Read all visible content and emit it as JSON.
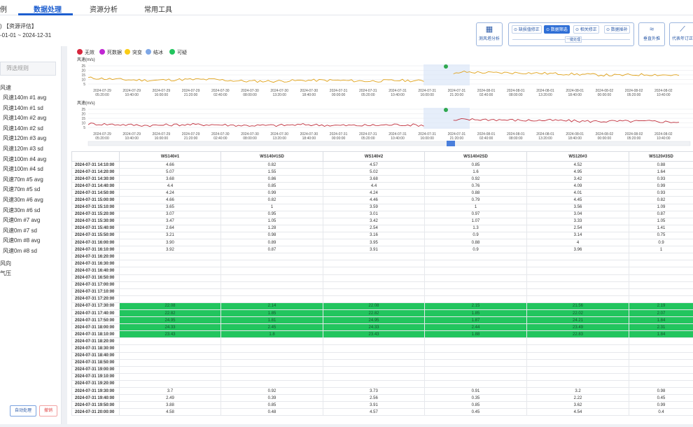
{
  "nav": {
    "tabs": [
      {
        "label": "例"
      },
      {
        "label": "数据处理"
      },
      {
        "label": "资源分析"
      },
      {
        "label": "常用工具"
      }
    ]
  },
  "header": {
    "project": ") 【资源评估】",
    "date_range": "-01-01 ~ 2024-12-31"
  },
  "toolbar": {
    "station_analysis": "测风塔分析",
    "group_items": [
      "缺损值修正",
      "数据筛选",
      "相关修正",
      "数据插补"
    ],
    "group_sub": "一键处理",
    "vertical_fit": "垂直外推",
    "rep_year": "代表年订正"
  },
  "sidebar": {
    "filter_placeholder": "筛选规则",
    "group_top": "风速",
    "items": [
      "风速140m #1 avg",
      "风速140m #1 sd",
      "风速140m #2 avg",
      "风速140m #2 sd",
      "风速120m #3 avg",
      "风速120m #3 sd",
      "风速100m #4 avg",
      "风速100m #4 sd",
      "风速70m #5 avg",
      "风速70m #5 sd",
      "风速30m #6 avg",
      "风速30m #6 sd",
      "风速0m #7 avg",
      "风速0m #7 sd",
      "风速0m #8 avg",
      "风速0m #8 sd"
    ],
    "group_dir": "风向",
    "group_pressure": "气压",
    "auto_btn": "自动处理",
    "undo_btn": "撤销"
  },
  "legend": [
    {
      "label": "无效",
      "color": "#d7263d"
    },
    {
      "label": "死数据",
      "color": "#c026d3"
    },
    {
      "label": "突变",
      "color": "#facc15"
    },
    {
      "label": "结冰",
      "color": "#7ea7e6"
    },
    {
      "label": "可疑",
      "color": "#22c55e"
    }
  ],
  "chart_data": [
    {
      "type": "line",
      "ylabel": "风速(m/s)",
      "yticks": [
        "25",
        "20",
        "15",
        "10",
        "5"
      ],
      "ylim": [
        0,
        25
      ],
      "series": [
        {
          "color": "#e0a21a"
        }
      ],
      "x": [
        "2024-07-29 05:20:00",
        "2024-07-29 10:40:00",
        "2024-07-29 16:00:00",
        "2024-07-29 21:20:00",
        "2024-07-30 02:40:00",
        "2024-07-30 08:00:00",
        "2024-07-30 13:20:00",
        "2024-07-30 18:40:00",
        "2024-07-31 00:00:00",
        "2024-07-31 05:20:00",
        "2024-07-31 10:40:00",
        "2024-07-31 16:00:00",
        "2024-07-31 21:20:00",
        "2024-08-01 02:40:00",
        "2024-08-01 08:00:00",
        "2024-08-01 13:20:00",
        "2024-08-01 18:40:00",
        "2024-08-02 00:00:00",
        "2024-08-02 05:20:00",
        "2024-08-02 10:40:00"
      ],
      "values": [
        9,
        7,
        6,
        7,
        7,
        5,
        5,
        6,
        6,
        5,
        6,
        5,
        16,
        15,
        15,
        14,
        13,
        12,
        13,
        12
      ]
    },
    {
      "type": "line",
      "ylabel": "风速(m/s)",
      "yticks": [
        "25",
        "20",
        "15",
        "10",
        "5"
      ],
      "ylim": [
        0,
        25
      ],
      "series": [
        {
          "color": "#c0303d"
        }
      ],
      "x": [
        "2024-07-29 05:20:00",
        "2024-07-29 10:40:00",
        "2024-07-29 16:00:00",
        "2024-07-29 21:20:00",
        "2024-07-30 02:40:00",
        "2024-07-30 08:00:00",
        "2024-07-30 13:20:00",
        "2024-07-30 18:40:00",
        "2024-07-31 00:00:00",
        "2024-07-31 05:20:00",
        "2024-07-31 10:40:00",
        "2024-07-31 16:00:00",
        "2024-07-31 21:20:00",
        "2024-08-01 02:40:00",
        "2024-08-01 08:00:00",
        "2024-08-01 13:20:00",
        "2024-08-01 18:40:00",
        "2024-08-02 00:00:00",
        "2024-08-02 05:20:00",
        "2024-08-02 10:40:00"
      ],
      "values": [
        6,
        5,
        4,
        5,
        5,
        4,
        4,
        5,
        4,
        4,
        5,
        4,
        11,
        11,
        10,
        10,
        9,
        9,
        9,
        8
      ]
    }
  ],
  "table": {
    "columns": [
      "",
      "WS140#1",
      "WS140#1SD",
      "WS140#2",
      "WS140#2SD",
      "WS120#3",
      "WS120#3SD"
    ],
    "rows": [
      {
        "ts": "2024-07-31 14:10:00",
        "v": [
          "4.66",
          "0.82",
          "4.57",
          "0.85",
          "4.52",
          "0.88"
        ]
      },
      {
        "ts": "2024-07-31 14:20:00",
        "v": [
          "5.07",
          "1.55",
          "5.02",
          "1.6",
          "4.95",
          "1.64"
        ]
      },
      {
        "ts": "2024-07-31 14:30:00",
        "v": [
          "3.68",
          "0.86",
          "3.68",
          "0.92",
          "3.42",
          "0.93"
        ]
      },
      {
        "ts": "2024-07-31 14:40:00",
        "v": [
          "4.4",
          "0.85",
          "4.4",
          "0.76",
          "4.09",
          "0.99"
        ]
      },
      {
        "ts": "2024-07-31 14:50:00",
        "v": [
          "4.24",
          "0.99",
          "4.24",
          "0.88",
          "4.01",
          "0.93"
        ]
      },
      {
        "ts": "2024-07-31 15:00:00",
        "v": [
          "4.66",
          "0.82",
          "4.46",
          "0.79",
          "4.45",
          "0.82"
        ]
      },
      {
        "ts": "2024-07-31 15:10:00",
        "v": [
          "3.65",
          "1",
          "3.59",
          "1",
          "3.56",
          "1.09"
        ]
      },
      {
        "ts": "2024-07-31 15:20:00",
        "v": [
          "3.07",
          "0.95",
          "3.01",
          "0.97",
          "3.04",
          "0.87"
        ]
      },
      {
        "ts": "2024-07-31 15:30:00",
        "v": [
          "3.47",
          "1.05",
          "3.42",
          "1.07",
          "3.33",
          "1.05"
        ]
      },
      {
        "ts": "2024-07-31 15:40:00",
        "v": [
          "2.64",
          "1.28",
          "2.54",
          "1.3",
          "2.54",
          "1.41"
        ]
      },
      {
        "ts": "2024-07-31 15:50:00",
        "v": [
          "3.21",
          "0.98",
          "3.16",
          "0.9",
          "3.14",
          "0.75"
        ]
      },
      {
        "ts": "2024-07-31 16:00:00",
        "v": [
          "3.90",
          "0.89",
          "3.95",
          "0.88",
          "4",
          "0.9"
        ]
      },
      {
        "ts": "2024-07-31 16:10:00",
        "v": [
          "3.92",
          "0.87",
          "3.91",
          "0.9",
          "3.96",
          "1"
        ]
      },
      {
        "ts": "2024-07-31 16:20:00",
        "v": [
          "",
          "",
          "",
          "",
          "",
          ""
        ]
      },
      {
        "ts": "2024-07-31 16:30:00",
        "v": [
          "",
          "",
          "",
          "",
          "",
          ""
        ]
      },
      {
        "ts": "2024-07-31 16:40:00",
        "v": [
          "",
          "",
          "",
          "",
          "",
          ""
        ]
      },
      {
        "ts": "2024-07-31 16:50:00",
        "v": [
          "",
          "",
          "",
          "",
          "",
          ""
        ]
      },
      {
        "ts": "2024-07-31 17:00:00",
        "v": [
          "",
          "",
          "",
          "",
          "",
          ""
        ]
      },
      {
        "ts": "2024-07-31 17:10:00",
        "v": [
          "",
          "",
          "",
          "",
          "",
          ""
        ]
      },
      {
        "ts": "2024-07-31 17:20:00",
        "v": [
          "",
          "",
          "",
          "",
          "",
          ""
        ]
      },
      {
        "ts": "2024-07-31 17:30:00",
        "hl": true,
        "v": [
          "22.08",
          "2.14",
          "22.08",
          "2.15",
          "21.56",
          "2.19"
        ]
      },
      {
        "ts": "2024-07-31 17:40:00",
        "hl": true,
        "v": [
          "22.82",
          "1.85",
          "22.82",
          "1.85",
          "22.02",
          "2.07"
        ]
      },
      {
        "ts": "2024-07-31 17:50:00",
        "hl": true,
        "v": [
          "24.95",
          "1.81",
          "24.95",
          "1.87",
          "24.21",
          "1.84"
        ]
      },
      {
        "ts": "2024-07-31 18:00:00",
        "hl": true,
        "v": [
          "24.33",
          "2.45",
          "24.33",
          "2.44",
          "23.49",
          "2.31"
        ]
      },
      {
        "ts": "2024-07-31 18:10:00",
        "hl": true,
        "v": [
          "23.43",
          "1.8",
          "23.43",
          "1.88",
          "22.83",
          "1.84"
        ]
      },
      {
        "ts": "2024-07-31 18:20:00",
        "v": [
          "",
          "",
          "",
          "",
          "",
          ""
        ]
      },
      {
        "ts": "2024-07-31 18:30:00",
        "v": [
          "",
          "",
          "",
          "",
          "",
          ""
        ]
      },
      {
        "ts": "2024-07-31 18:40:00",
        "v": [
          "",
          "",
          "",
          "",
          "",
          ""
        ]
      },
      {
        "ts": "2024-07-31 18:50:00",
        "v": [
          "",
          "",
          "",
          "",
          "",
          ""
        ]
      },
      {
        "ts": "2024-07-31 19:00:00",
        "v": [
          "",
          "",
          "",
          "",
          "",
          ""
        ]
      },
      {
        "ts": "2024-07-31 19:10:00",
        "v": [
          "",
          "",
          "",
          "",
          "",
          ""
        ]
      },
      {
        "ts": "2024-07-31 19:20:00",
        "v": [
          "",
          "",
          "",
          "",
          "",
          ""
        ]
      },
      {
        "ts": "2024-07-31 19:30:00",
        "v": [
          "3.7",
          "0.92",
          "3.73",
          "0.91",
          "3.2",
          "0.98"
        ]
      },
      {
        "ts": "2024-07-31 19:40:00",
        "v": [
          "2.49",
          "0.39",
          "2.56",
          "0.35",
          "2.22",
          "0.45"
        ]
      },
      {
        "ts": "2024-07-31 19:50:00",
        "v": [
          "3.88",
          "0.85",
          "3.91",
          "0.85",
          "3.62",
          "0.99"
        ]
      },
      {
        "ts": "2024-07-31 20:00:00",
        "v": [
          "4.58",
          "0.48",
          "4.57",
          "0.45",
          "4.54",
          "0.4"
        ]
      }
    ]
  }
}
